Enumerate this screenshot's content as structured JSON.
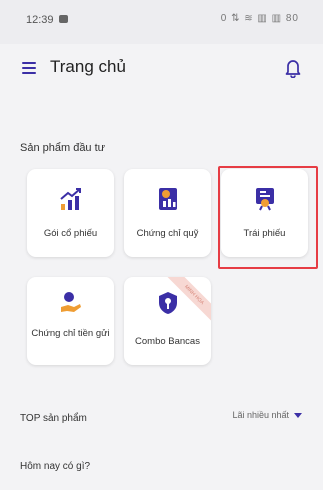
{
  "status_bar": {
    "time": "12:39",
    "icons": "0 ⇅ ≋ ▥ ▥ 80"
  },
  "header": {
    "title": "Trang chủ"
  },
  "products": {
    "section_title": "Sản phẩm đầu tư",
    "items": [
      {
        "label": "Gói cổ phiếu",
        "icon": "stock-growth-icon"
      },
      {
        "label": "Chứng chỉ quỹ",
        "icon": "fund-certificate-icon"
      },
      {
        "label": "Trái phiếu",
        "icon": "bond-icon"
      },
      {
        "label": "Chứng chỉ tiền gửi",
        "icon": "deposit-certificate-icon"
      },
      {
        "label": "Combo Bancas",
        "icon": "bancas-combo-icon",
        "ribbon": "MINH HỌA"
      }
    ]
  },
  "top_products": {
    "title": "TOP sản phẩm",
    "sort_label": "Lãi nhiều nhất"
  },
  "today": {
    "title": "Hôm nay có gì?"
  },
  "colors": {
    "accent": "#3b2fa6",
    "highlight": "#e63c44",
    "icon_orange": "#ef9d33",
    "background": "#f3f3f5"
  }
}
